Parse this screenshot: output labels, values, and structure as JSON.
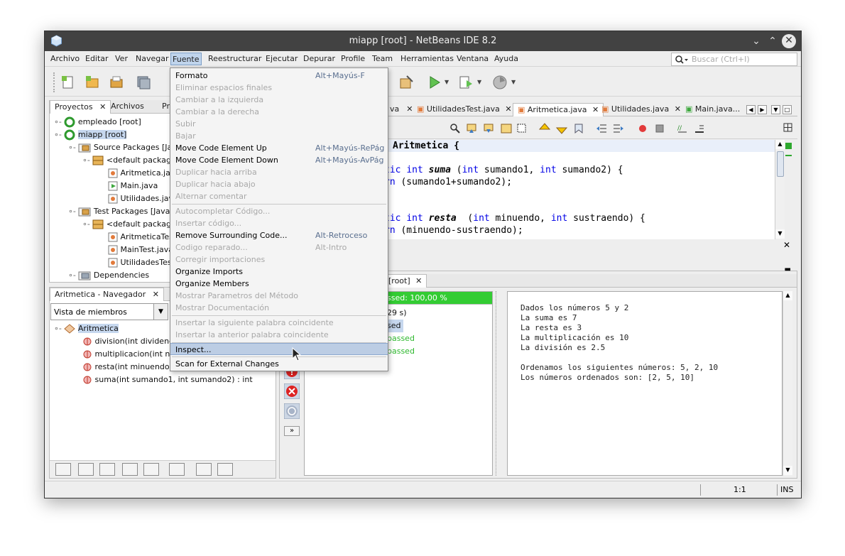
{
  "window": {
    "title": "miapp [root] - NetBeans IDE 8.2"
  },
  "menubar": {
    "items": [
      "Archivo",
      "Editar",
      "Ver",
      "Navegar",
      "Fuente",
      "Reestructurar",
      "Ejecutar",
      "Depurar",
      "Profile",
      "Team",
      "Herramientas",
      "Ventana",
      "Ayuda"
    ],
    "active": "Fuente",
    "search_placeholder": "Buscar (Ctrl+I)"
  },
  "projects_panel": {
    "tabs": [
      "Proyectos",
      "Archivos",
      "Pre"
    ],
    "tree": [
      {
        "label": "empleado [root]"
      },
      {
        "label": "miapp [root]"
      },
      {
        "label": "Source Packages [Ja"
      },
      {
        "label": "<default package"
      },
      {
        "label": "Aritmetica.jav"
      },
      {
        "label": "Main.java"
      },
      {
        "label": "Utilidades.jav"
      },
      {
        "label": "Test Packages [Java"
      },
      {
        "label": "<default package"
      },
      {
        "label": "AritmeticaTes"
      },
      {
        "label": "MainTest.java"
      },
      {
        "label": "UtilidadesTes"
      },
      {
        "label": "Dependencies"
      }
    ]
  },
  "navigator": {
    "title": "Aritmetica - Navegador",
    "filter": "Vista de miembros",
    "class_name": "Aritmetica",
    "members": [
      {
        "label": "division(int dividendo,"
      },
      {
        "label": "multiplicacion(int num"
      },
      {
        "label": "resta(int minuendo, in"
      },
      {
        "label": "suma(int sumando1, int sumando2) : int"
      }
    ]
  },
  "editor": {
    "tabs": [
      "va",
      "UtilidadesTest.java",
      "Aritmetica.java",
      "Utilidades.java",
      "Main.java..."
    ],
    "selected_tab": "Aritmetica.java",
    "code": {
      "l1": "Aritmetica {",
      "l2_kw1": "tic",
      "l2_kw2": "int",
      "l2_name": "suma",
      "l2_paren": " (",
      "l2_kw3": "int",
      "l2_a": " sumando1, ",
      "l2_kw4": "int",
      "l2_b": " sumando2) {",
      "l3_kw": "rn",
      "l3_rest": " (sumando1+sumando2);",
      "l4_kw1": "tic",
      "l4_kw2": "int",
      "l4_name": "resta",
      "l4_paren": "  (",
      "l4_kw3": "int",
      "l4_a": " minuendo, ",
      "l4_kw4": "int",
      "l4_b": " sustraendo) {",
      "l5_kw": "rn",
      "l5_rest": " (minuendo-sustraendo);"
    }
  },
  "test_results": {
    "tab_label": "[root]",
    "progress_text": "ssed: 100,00 %",
    "progress": 1.0,
    "rows": [
      "29 s)",
      "sed",
      "passed",
      "passed"
    ],
    "more_button": "»"
  },
  "output": {
    "lines": [
      "Dados los números 5 y 2",
      "La suma es 7",
      "La resta es 3",
      "La multiplicación es 10",
      "La división es 2.5",
      "",
      "Ordenamos los siguientes números: 5, 2, 10",
      "Los números ordenados son: [2, 5, 10]"
    ]
  },
  "fuente_menu": {
    "items": [
      {
        "label": "Formato",
        "shortcut": "Alt+Mayús-F",
        "enabled": true
      },
      {
        "label": "Eliminar espacios finales",
        "shortcut": "",
        "enabled": false
      },
      {
        "label": "Cambiar a la izquierda",
        "shortcut": "",
        "enabled": false
      },
      {
        "label": "Cambiar a la derecha",
        "shortcut": "",
        "enabled": false
      },
      {
        "label": "Subir",
        "shortcut": "",
        "enabled": false
      },
      {
        "label": "Bajar",
        "shortcut": "",
        "enabled": false
      },
      {
        "label": "Move Code Element Up",
        "shortcut": "Alt+Mayús-RePág",
        "enabled": true
      },
      {
        "label": "Move Code Element Down",
        "shortcut": "Alt+Mayús-AvPág",
        "enabled": true
      },
      {
        "label": "Duplicar hacia arriba",
        "shortcut": "",
        "enabled": false
      },
      {
        "label": "Duplicar hacia abajo",
        "shortcut": "",
        "enabled": false
      },
      {
        "label": "Alternar comentar",
        "shortcut": "",
        "enabled": false
      },
      {
        "label": "Autocompletar Código...",
        "shortcut": "",
        "enabled": false
      },
      {
        "label": "Insertar código...",
        "shortcut": "",
        "enabled": false
      },
      {
        "label": "Remove Surrounding Code...",
        "shortcut": "Alt-Retroceso",
        "enabled": true
      },
      {
        "label": "Codigo reparado...",
        "shortcut": "Alt-Intro",
        "enabled": false
      },
      {
        "label": "Corregir importaciones",
        "shortcut": "",
        "enabled": false
      },
      {
        "label": "Organize Imports",
        "shortcut": "",
        "enabled": true
      },
      {
        "label": "Organize Members",
        "shortcut": "",
        "enabled": true
      },
      {
        "label": "Mostrar Parametros del Método",
        "shortcut": "",
        "enabled": false
      },
      {
        "label": "Mostrar Documentación",
        "shortcut": "",
        "enabled": false
      },
      {
        "label": "Insertar la siguiente palabra coincidente",
        "shortcut": "",
        "enabled": false
      },
      {
        "label": "Insertar la anterior palabra coincidente",
        "shortcut": "",
        "enabled": false
      },
      {
        "label": "Inspect...",
        "shortcut": "",
        "enabled": true,
        "highlighted": true
      },
      {
        "label": "Scan for External Changes",
        "shortcut": "",
        "enabled": true
      }
    ]
  },
  "statusbar": {
    "position": "1:1",
    "mode": "INS"
  },
  "colors": {
    "titlebar": "#424242",
    "keyword": "#0000e6",
    "passed": "#33cc33",
    "menu_highlight": "#bccde4"
  }
}
